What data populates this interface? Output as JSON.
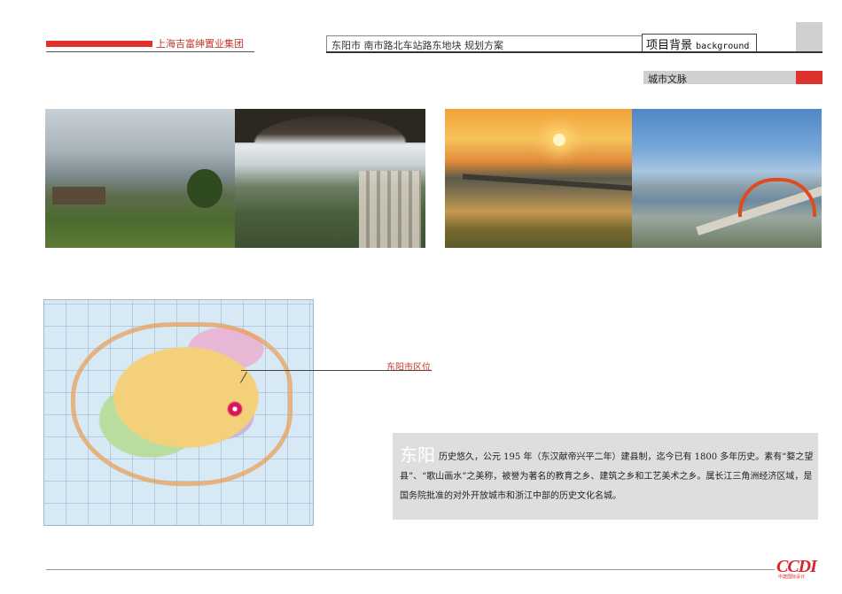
{
  "header": {
    "company": "上海吉富绅置业集团",
    "project_title": "东阳市  南市路北车站路东地块  规划方案",
    "section_title_cn": "项目背景",
    "section_title_en": "background"
  },
  "subheader": {
    "label": "城市文脉"
  },
  "photos": [
    {
      "name": "mountain-village-photo"
    },
    {
      "name": "cliff-temple-photo"
    },
    {
      "name": "sunset-river-bridge-photo"
    },
    {
      "name": "city-river-arch-bridge-photo"
    }
  ],
  "map": {
    "locator_label": "东阳市区位"
  },
  "description": {
    "title": "东阳",
    "body": "历史悠久，公元 195 年（东汉献帝兴平二年）建县制，迄今已有 1800 多年历史。素有“婺之望县”、“歌山画水”之美称，被誉为著名的教育之乡、建筑之乡和工艺美术之乡。属长江三角洲经济区域，是国务院批准的对外开放城市和浙江中部的历史文化名城。"
  },
  "footer": {
    "logo": "CCDI",
    "logo_sub": "中建国际设计"
  },
  "colors": {
    "accent_red": "#e0322c",
    "grey_bar": "#d0d0d0",
    "desc_bg": "#dedede"
  }
}
